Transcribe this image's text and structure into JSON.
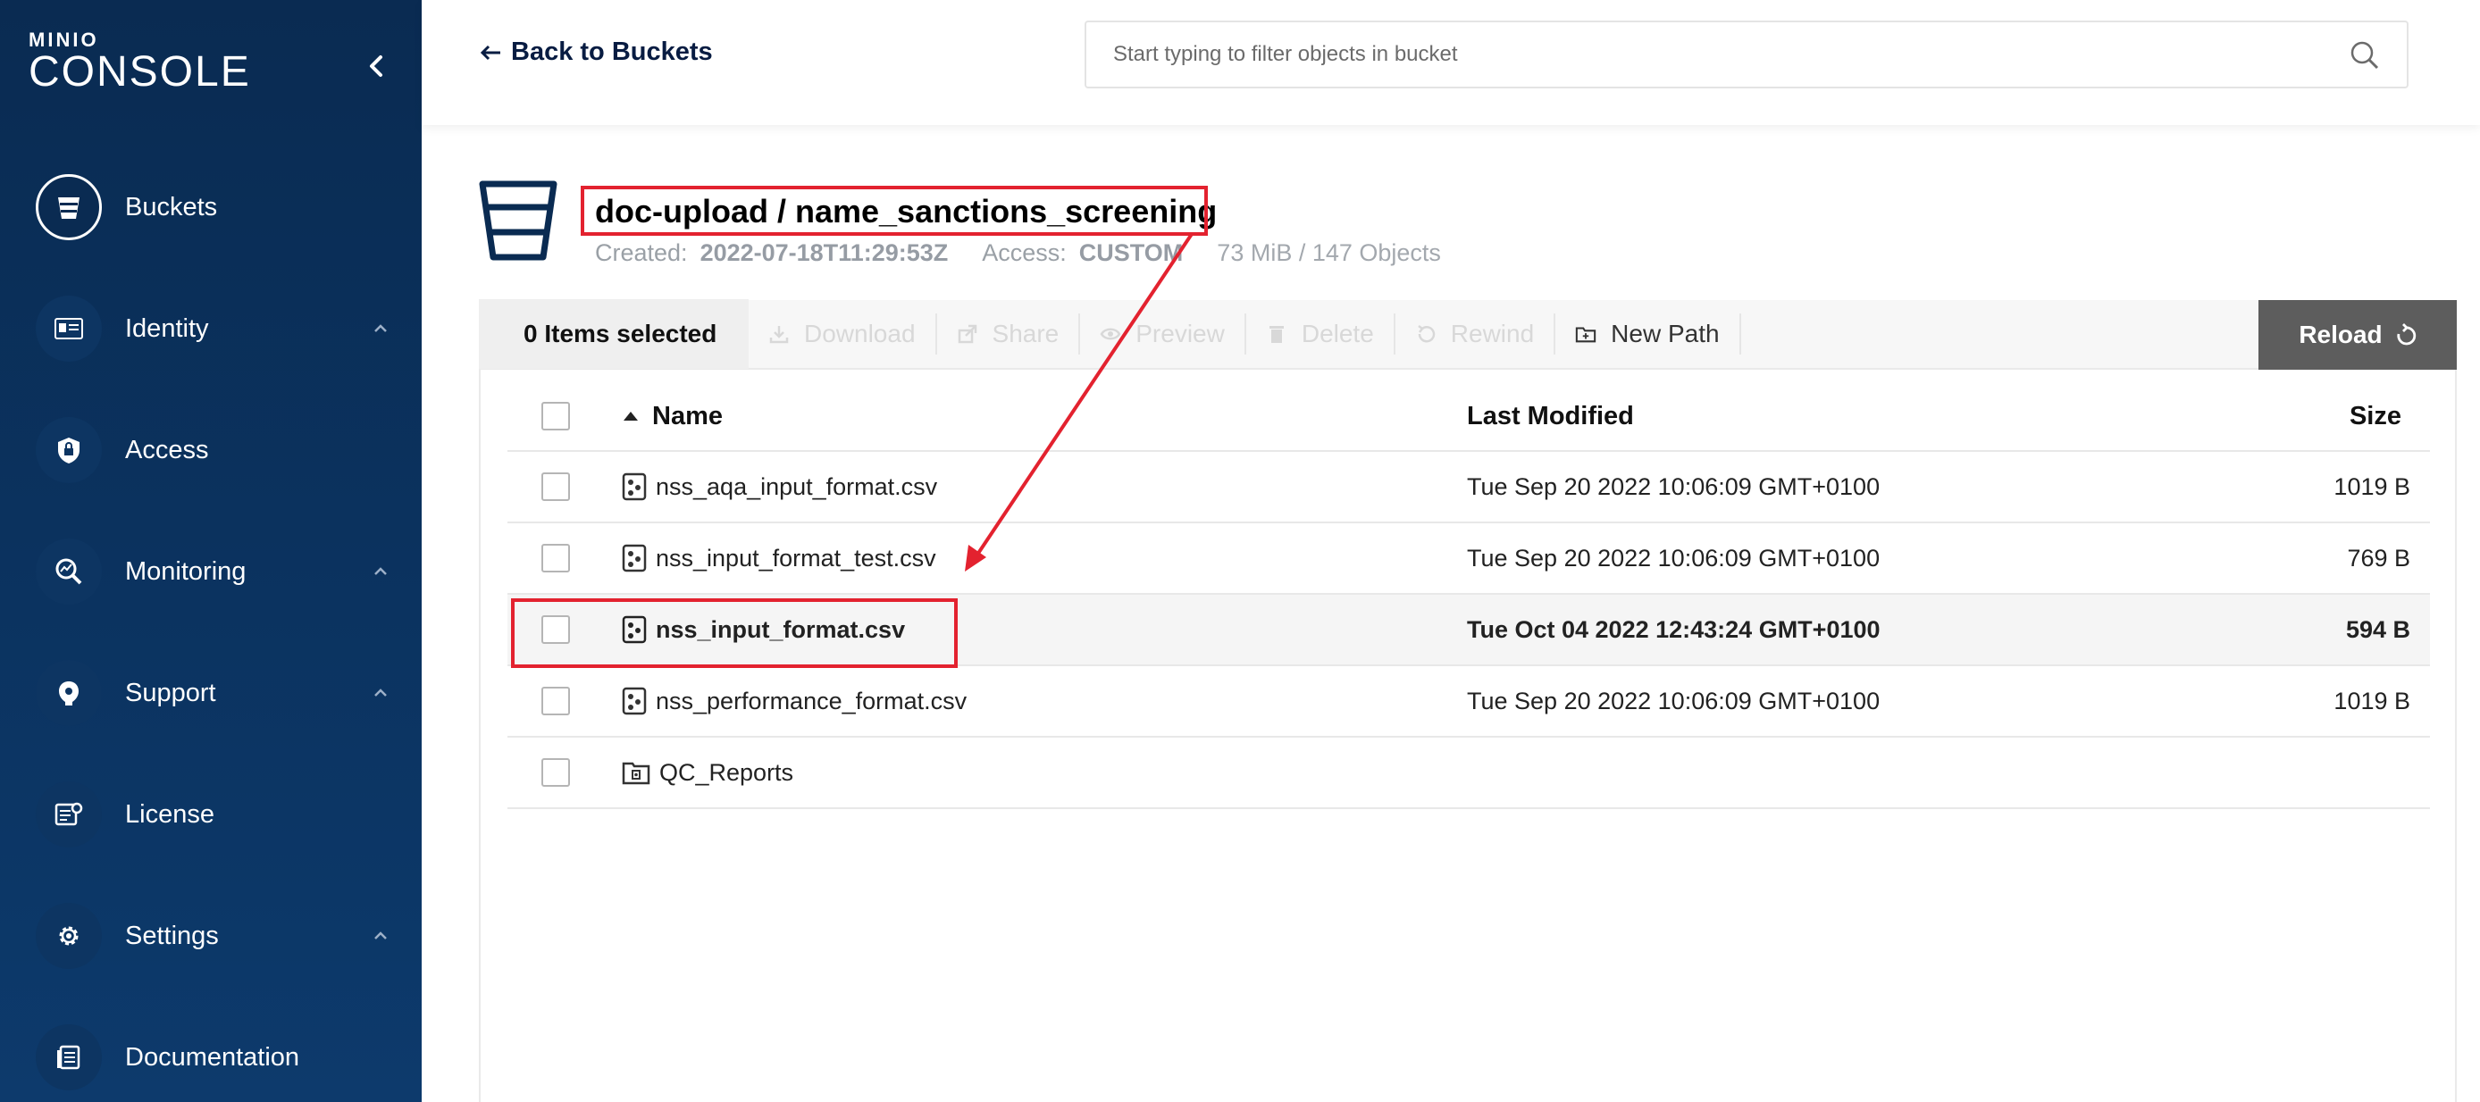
{
  "sidebar": {
    "logo_small": "MINIO",
    "logo_big": "CONSOLE",
    "items": [
      {
        "label": "Buckets",
        "icon": "bucket-icon"
      },
      {
        "label": "Identity",
        "icon": "id-card-icon"
      },
      {
        "label": "Access",
        "icon": "lock-shield-icon"
      },
      {
        "label": "Monitoring",
        "icon": "search-chart-icon"
      },
      {
        "label": "Support",
        "icon": "support-icon"
      },
      {
        "label": "License",
        "icon": "license-icon"
      },
      {
        "label": "Settings",
        "icon": "gear-icon"
      },
      {
        "label": "Documentation",
        "icon": "document-icon"
      }
    ]
  },
  "header": {
    "back_label": "Back to Buckets",
    "search_placeholder": "Start typing to filter objects in bucket"
  },
  "bucket": {
    "title": "doc-upload / name_sanctions_screening",
    "created_label": "Created:",
    "created_value": "2022-07-18T11:29:53Z",
    "access_label": "Access:",
    "access_value": "CUSTOM",
    "usage": "73 MiB / 147 Objects"
  },
  "toolbar": {
    "selected": "0 Items selected",
    "download": "Download",
    "share": "Share",
    "preview": "Preview",
    "delete": "Delete",
    "rewind": "Rewind",
    "new_path": "New Path",
    "reload": "Reload"
  },
  "table": {
    "columns": {
      "name": "Name",
      "modified": "Last Modified",
      "size": "Size"
    },
    "rows": [
      {
        "name": "nss_aqa_input_format.csv",
        "modified": "Tue Sep 20 2022 10:06:09 GMT+0100",
        "size": "1019 B",
        "type": "file"
      },
      {
        "name": "nss_input_format_test.csv",
        "modified": "Tue Sep 20 2022 10:06:09 GMT+0100",
        "size": "769 B",
        "type": "file"
      },
      {
        "name": "nss_input_format.csv",
        "modified": "Tue Oct 04 2022 12:43:24 GMT+0100",
        "size": "594 B",
        "type": "file"
      },
      {
        "name": "nss_performance_format.csv",
        "modified": "Tue Sep 20 2022 10:06:09 GMT+0100",
        "size": "1019 B",
        "type": "file"
      },
      {
        "name": "QC_Reports",
        "modified": "",
        "size": "",
        "type": "folder"
      }
    ]
  },
  "colors": {
    "sidebar": "#0b3360",
    "annotation": "#e3222f",
    "reload": "#5d5d5d"
  }
}
